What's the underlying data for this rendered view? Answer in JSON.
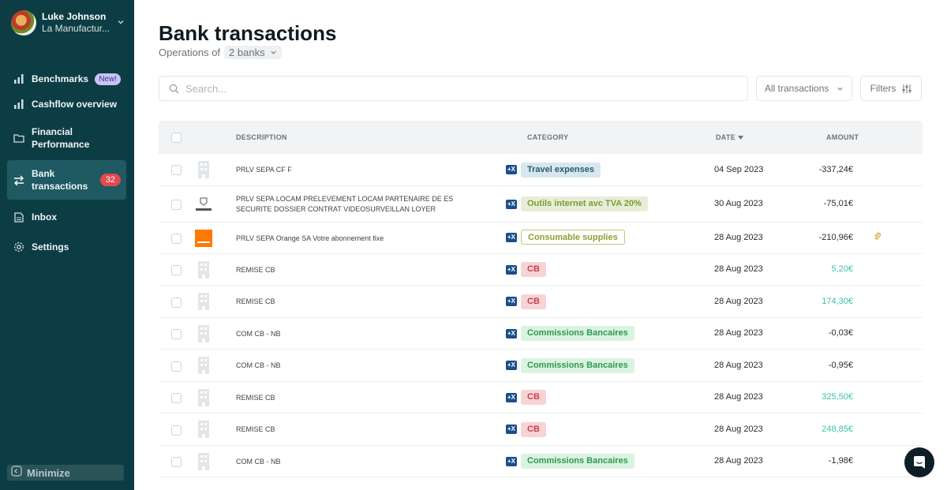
{
  "user": {
    "name": "Luke Johnson",
    "org": "La Manufactur..."
  },
  "nav": {
    "benchmarks": "Benchmarks",
    "benchmarks_badge": "New!",
    "cashflow": "Cashflow overview",
    "financial": "Financial Performance",
    "bank": "Bank transactions",
    "bank_badge": "32",
    "inbox": "Inbox",
    "settings": "Settings",
    "minimize": "Minimize"
  },
  "header": {
    "title": "Bank transactions",
    "subtitle": "Operations of",
    "bank_select": "2 banks"
  },
  "search": {
    "placeholder": "Search..."
  },
  "transactions_select": "All transactions",
  "filters_label": "Filters",
  "table": {
    "columns": {
      "description": "DESCRIPTION",
      "category": "CATEGORY",
      "date": "DATE",
      "amount": "AMOUNT"
    },
    "rows": [
      {
        "description": "PRLV SEPA CF F",
        "category": "Travel expenses",
        "date": "04 Sep 2023",
        "amount": "-337,24€"
      },
      {
        "description": "PRLV SEPA LOCAM PRELEVEMENT LOCAM PARTENAIRE DE ES SECURITE DOSSIER CONTRAT VIDEOSURVEILLAN LOYER",
        "category": "Outils internet avc TVA 20%",
        "date": "30 Aug 2023",
        "amount": "-75,01€"
      },
      {
        "description": "PRLV SEPA Orange SA Votre abonnement fixe",
        "category": "Consumable supplies",
        "date": "28 Aug 2023",
        "amount": "-210,96€"
      },
      {
        "description": "REMISE CB",
        "category": "CB",
        "date": "28 Aug 2023",
        "amount": "5,20€"
      },
      {
        "description": "REMISE CB",
        "category": "CB",
        "date": "28 Aug 2023",
        "amount": "174,30€"
      },
      {
        "description": "COM CB - NB",
        "category": "Commissions Bancaires",
        "date": "28 Aug 2023",
        "amount": "-0,03€"
      },
      {
        "description": "COM CB - NB",
        "category": "Commissions Bancaires",
        "date": "28 Aug 2023",
        "amount": "-0,95€"
      },
      {
        "description": "REMISE CB",
        "category": "CB",
        "date": "28 Aug 2023",
        "amount": "325,50€"
      },
      {
        "description": "REMISE CB",
        "category": "CB",
        "date": "28 Aug 2023",
        "amount": "248,85€"
      },
      {
        "description": "COM CB - NB",
        "category": "Commissions Bancaires",
        "date": "28 Aug 2023",
        "amount": "-1,98€"
      }
    ]
  },
  "colors": {
    "sidebar": "#0d3d44",
    "positive_amount": "#3cc0a8",
    "badge_red": "#e5484d"
  }
}
